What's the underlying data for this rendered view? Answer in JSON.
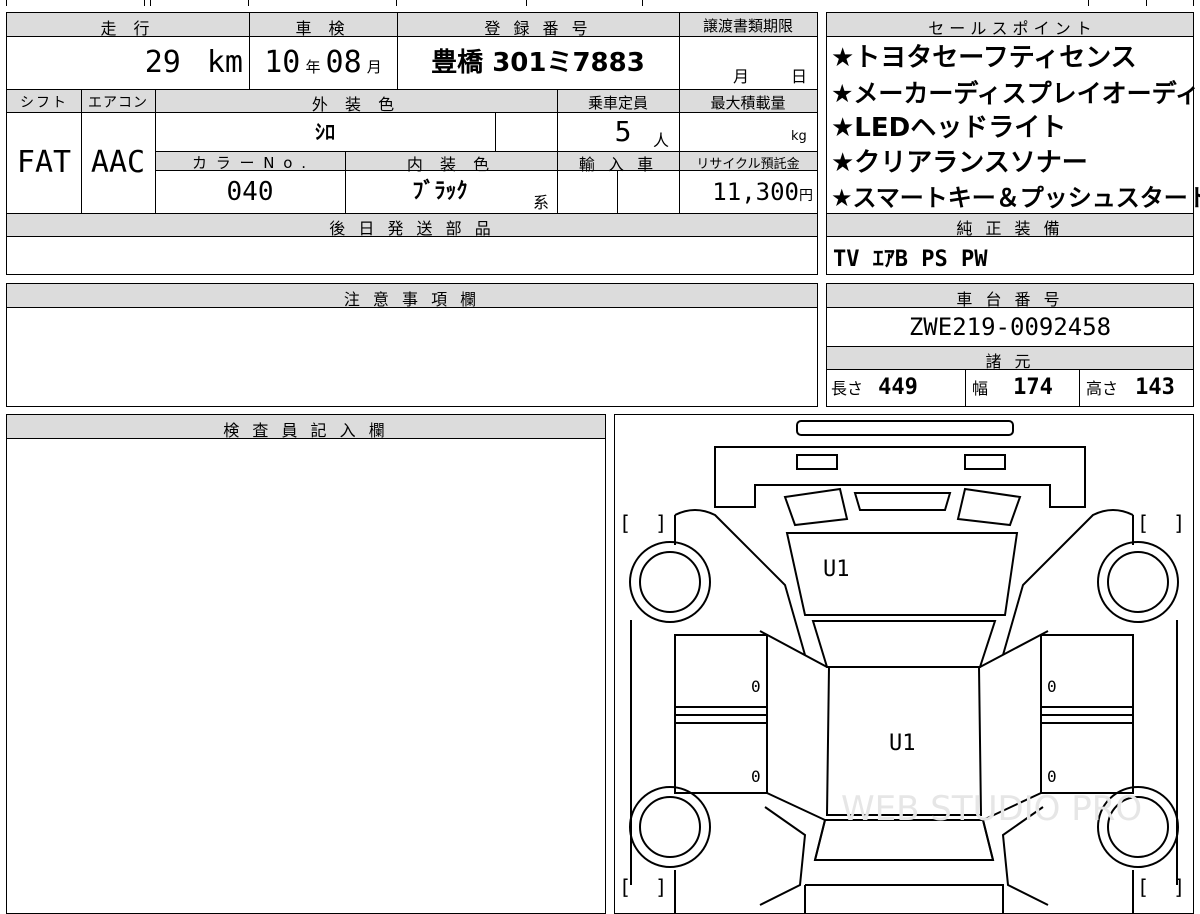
{
  "vehicle": {
    "mileage_label": "走 行",
    "mileage_value": "29",
    "mileage_unit": "km",
    "inspection_label": "車 検",
    "inspection_year": "10",
    "inspection_year_unit": "年",
    "inspection_month": "08",
    "inspection_month_unit": "月",
    "registration_label": "登 録 番 号",
    "registration_value": "豊橋 301ミ7883",
    "transfer_label": "譲渡書類期限",
    "transfer_month_unit": "月",
    "transfer_day_unit": "日",
    "shift_label": "シフト",
    "shift_value": "FAT",
    "aircon_label": "エアコン",
    "aircon_value": "AAC",
    "exterior_label": "外 装 色",
    "exterior_value": "ｼﾛ",
    "capacity_label": "乗車定員",
    "capacity_value": "5",
    "capacity_unit": "人",
    "max_load_label": "最大積載量",
    "max_load_unit": "kg",
    "color_no_label": "カ ラ ー N o .",
    "color_no_value": "040",
    "interior_label": "内 装 色",
    "interior_value": "ﾌﾞﾗｯｸ",
    "interior_suffix": "系",
    "import_label": "輸 入 車",
    "recycle_label": "リサイクル預託金",
    "recycle_value": "11,300",
    "recycle_unit": "円",
    "parts_label": "後 日 発 送 部 品"
  },
  "sales_points": {
    "title": "セ ー ル ス ポ イ ン ト",
    "items": [
      "★トヨタセーフティセンス",
      "★メーカーディスプレイオーディオ",
      "★LEDヘッドライト",
      "★クリアランスソナー",
      "★スマートキー＆プッシュスタート"
    ]
  },
  "equipment": {
    "title": "純 正 装 備",
    "value": "TV ｴｱB PS PW"
  },
  "notes": {
    "title": "注 意 事 項 欄"
  },
  "chassis": {
    "title": "車 台 番 号",
    "value": "ZWE219-0092458"
  },
  "specs": {
    "title": "諸 元",
    "length_label": "長さ",
    "length_value": "449",
    "width_label": "幅",
    "width_value": "174",
    "height_label": "高さ",
    "height_value": "143"
  },
  "inspector": {
    "title": "検 査 員 記 入 欄"
  },
  "diagram": {
    "mark_hood": "U1",
    "mark_roof": "U1",
    "mark_left_front_door": "0",
    "mark_left_rear_door": "0",
    "mark_right_front_door": "0",
    "mark_right_rear_door": "0",
    "bracket": "[  ]",
    "watermark": "WEB STUDIO PRO"
  }
}
